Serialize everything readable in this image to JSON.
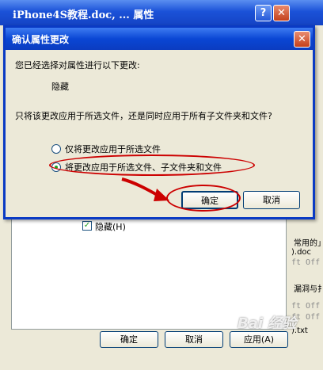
{
  "background_window": {
    "title": "iPhone4S教程.doc, ... 属性",
    "help_label": "?",
    "close_label": "✕",
    "hidden_checkbox_label": "隐藏(H)",
    "right_edge_texts": [
      "常用的」",
      ").doc",
      "ft Off",
      "漏洞与扌",
      "ft Off",
      "ft Off",
      ").txt"
    ],
    "buttons": {
      "ok": "确定",
      "cancel": "取消",
      "apply": "应用(A)"
    },
    "watermark": "Bai 经验"
  },
  "dialog": {
    "title": "确认属性更改",
    "close_label": "✕",
    "prompt": "您已经选择对属性进行以下更改:",
    "attribute": "隐藏",
    "question": "只将该更改应用于所选文件，还是同时应用于所有子文件夹和文件?",
    "options": [
      {
        "label": "仅将更改应用于所选文件",
        "selected": false
      },
      {
        "label": "将更改应用于所选文件、子文件夹和文件",
        "selected": true
      }
    ],
    "buttons": {
      "ok": "确定",
      "cancel": "取消"
    }
  }
}
